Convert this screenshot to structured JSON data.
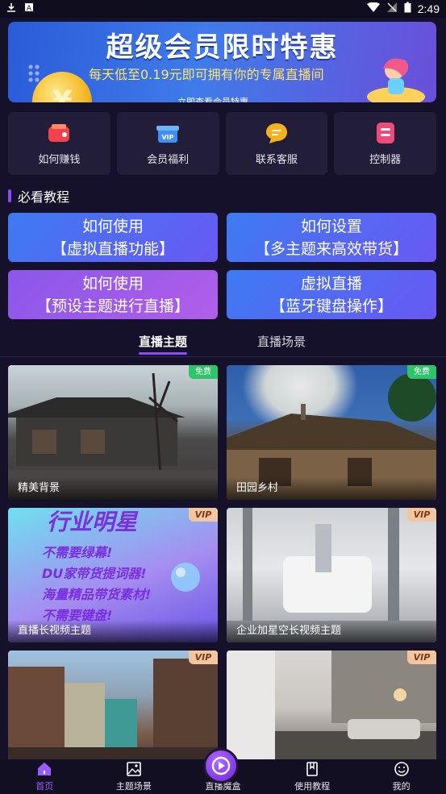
{
  "status_bar": {
    "time": "2:49",
    "left_icons": [
      "download-icon",
      "a-icon"
    ],
    "right_icons": [
      "wifi-icon",
      "no-signal-icon",
      "battery-icon"
    ]
  },
  "banner": {
    "title": "超级会员限时特惠",
    "subtitle": "每天低至0.19元即可拥有你的专属直播间",
    "coin_symbol": "¥",
    "footer_text": "立即查看会员特惠"
  },
  "quick_actions": [
    {
      "label": "如何赚钱",
      "icon": "wallet-icon"
    },
    {
      "label": "会员福利",
      "icon": "vip-gift-icon"
    },
    {
      "label": "联系客服",
      "icon": "chat-icon"
    },
    {
      "label": "控制器",
      "icon": "controller-icon"
    }
  ],
  "section": {
    "title": "必看教程"
  },
  "tutorials": [
    {
      "line1": "如何使用",
      "line2": "【虚拟直播功能】"
    },
    {
      "line1": "如何设置",
      "line2": "【多主题来高效带货】"
    },
    {
      "line1": "如何使用",
      "line2": "【预设主题进行直播】"
    },
    {
      "line1": "虚拟直播",
      "line2": "【蓝牙键盘操作】"
    }
  ],
  "tabs": {
    "active": "直播主题",
    "inactive": "直播场景"
  },
  "themes": [
    {
      "label": "精美背景",
      "badge": "免费"
    },
    {
      "label": "田园乡村",
      "badge": "免费"
    },
    {
      "label": "直播长视频主题",
      "badge": "VIP",
      "star_lines": [
        "行业明星",
        "不需要绿幕!",
        "DU家带货提词器!",
        "海量精品带货素材!",
        "不需要键盘!"
      ]
    },
    {
      "label": "企业加星空长视频主题",
      "badge": "VIP"
    },
    {
      "label": "",
      "badge": "VIP"
    },
    {
      "label": "",
      "badge": "VIP"
    }
  ],
  "bottom_nav": [
    {
      "label": "首页",
      "icon": "home-icon"
    },
    {
      "label": "主题场景",
      "icon": "image-icon"
    },
    {
      "label": "直播魔盒",
      "icon": "live-box-icon"
    },
    {
      "label": "使用教程",
      "icon": "book-icon"
    },
    {
      "label": "我的",
      "icon": "smile-icon"
    }
  ],
  "colors": {
    "background": "#15112a",
    "accent": "#8d4bff",
    "free_badge": "#2ec46a",
    "vip_badge": "#f3c6a0"
  }
}
